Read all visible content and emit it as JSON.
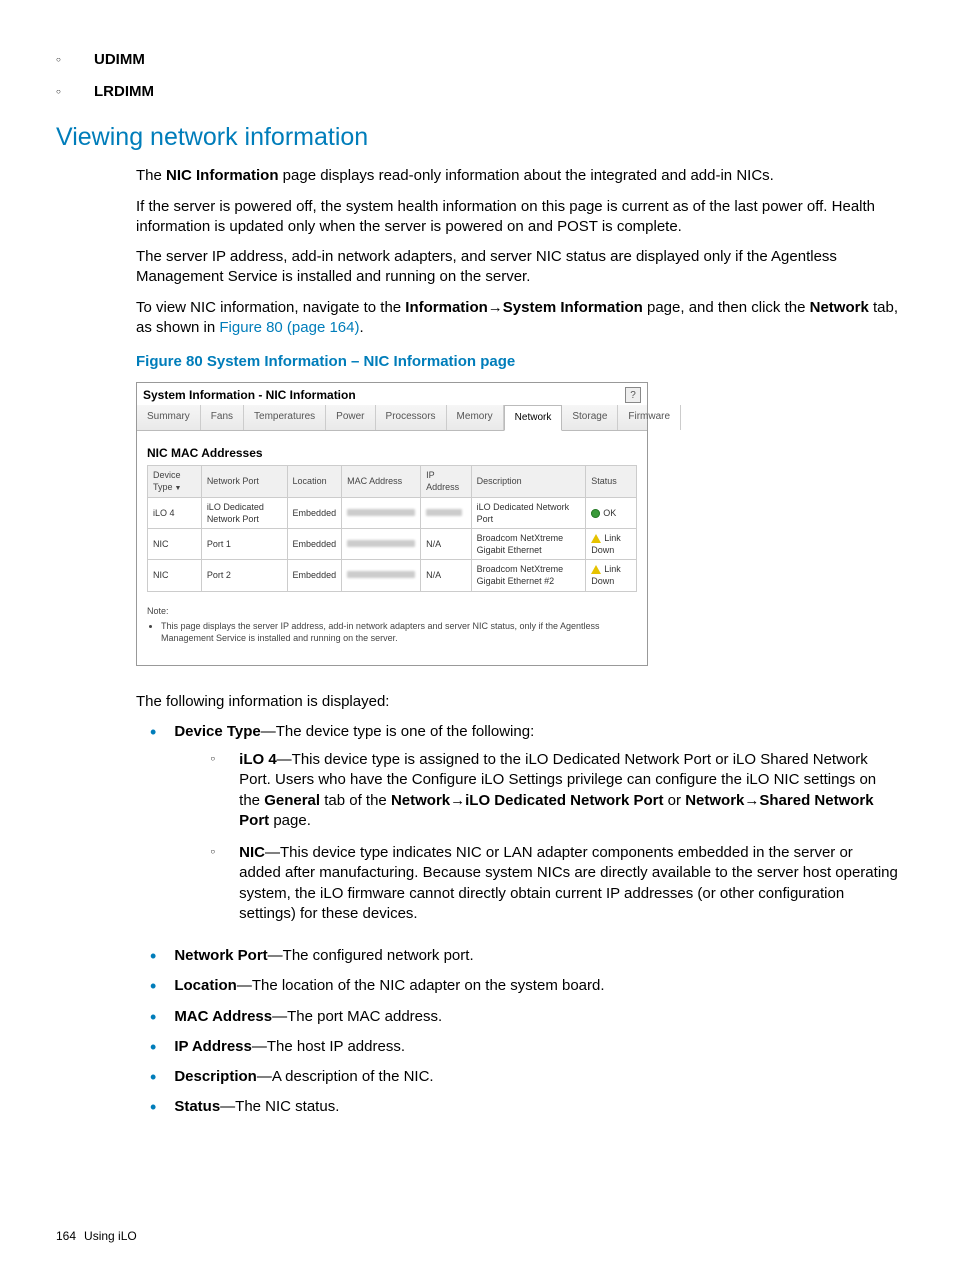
{
  "top_sublist": {
    "item1": "UDIMM",
    "item2": "LRDIMM"
  },
  "heading": "Viewing network information",
  "para1_a": "The ",
  "para1_b": "NIC Information",
  "para1_c": " page displays read-only information about the integrated and add-in NICs.",
  "para2": "If the server is powered off, the system health information on this page is current as of the last power off. Health information is updated only when the server is powered on and POST is complete.",
  "para3": "The server IP address, add-in network adapters, and server NIC status are displayed only if the Agentless Management Service is installed and running on the server.",
  "para4_a": "To view NIC information, navigate to the ",
  "para4_b": "Information",
  "para4_arrow": "→",
  "para4_c": "System Information",
  "para4_d": " page, and then click the ",
  "para4_e": "Network",
  "para4_f": " tab, as shown in ",
  "para4_link": "Figure 80 (page 164)",
  "para4_g": ".",
  "fig_caption": "Figure 80 System Information – NIC Information page",
  "panel": {
    "title": "System Information - NIC Information",
    "tabs": {
      "t0": "Summary",
      "t1": "Fans",
      "t2": "Temperatures",
      "t3": "Power",
      "t4": "Processors",
      "t5": "Memory",
      "t6": "Network",
      "t7": "Storage",
      "t8": "Firmware"
    },
    "subheading": "NIC MAC Addresses",
    "headers": {
      "h0": "Device Type",
      "h1": "Network Port",
      "h2": "Location",
      "h3": "MAC Address",
      "h4": "IP Address",
      "h5": "Description",
      "h6": "Status"
    },
    "rows": {
      "r0": {
        "c0": "iLO 4",
        "c1": "iLO Dedicated Network Port",
        "c2": "Embedded",
        "c4": "",
        "c5": "iLO Dedicated Network Port",
        "c6": "OK"
      },
      "r1": {
        "c0": "NIC",
        "c1": "Port 1",
        "c2": "Embedded",
        "c4": "N/A",
        "c5": "Broadcom NetXtreme Gigabit Ethernet",
        "c6": "Link Down"
      },
      "r2": {
        "c0": "NIC",
        "c1": "Port 2",
        "c2": "Embedded",
        "c4": "N/A",
        "c5": "Broadcom NetXtreme Gigabit Ethernet #2",
        "c6": "Link Down"
      }
    },
    "note_label": "Note:",
    "note_text": "This page displays the server IP address, add-in network adapters and server NIC status, only if the Agentless Management Service is installed and running on the server."
  },
  "after_fig": "The following information is displayed:",
  "list": {
    "device_type_label": "Device Type",
    "device_type_text": "—The device type is one of the following:",
    "ilo4_label": "iLO 4",
    "ilo4_text_a": "—This device type is assigned to the iLO Dedicated Network Port or iLO Shared Network Port. Users who have the Configure iLO Settings privilege can configure the iLO NIC settings on the ",
    "ilo4_general": "General",
    "ilo4_text_b": " tab of the ",
    "ilo4_net": "Network",
    "ilo4_arrow": "→",
    "ilo4_dnp": "iLO Dedicated Network Port",
    "ilo4_or": " or ",
    "ilo4_net2": "Network",
    "ilo4_snp": "Shared Network Port",
    "ilo4_page": " page.",
    "nic_label": "NIC",
    "nic_text": "—This device type indicates NIC or LAN adapter components embedded in the server or added after manufacturing. Because system NICs are directly available to the server host operating system, the iLO firmware cannot directly obtain current IP addresses (or other configuration settings) for these devices.",
    "np_label": "Network Port",
    "np_text": "—The configured network port.",
    "loc_label": "Location",
    "loc_text": "—The location of the NIC adapter on the system board.",
    "mac_label": "MAC Address",
    "mac_text": "—The port MAC address.",
    "ip_label": "IP Address",
    "ip_text": "—The host IP address.",
    "desc_label": "Description",
    "desc_text": "—A description of the NIC.",
    "status_label": "Status",
    "status_text": "—The NIC status."
  },
  "footer": {
    "page": "164",
    "section": "Using iLO"
  }
}
